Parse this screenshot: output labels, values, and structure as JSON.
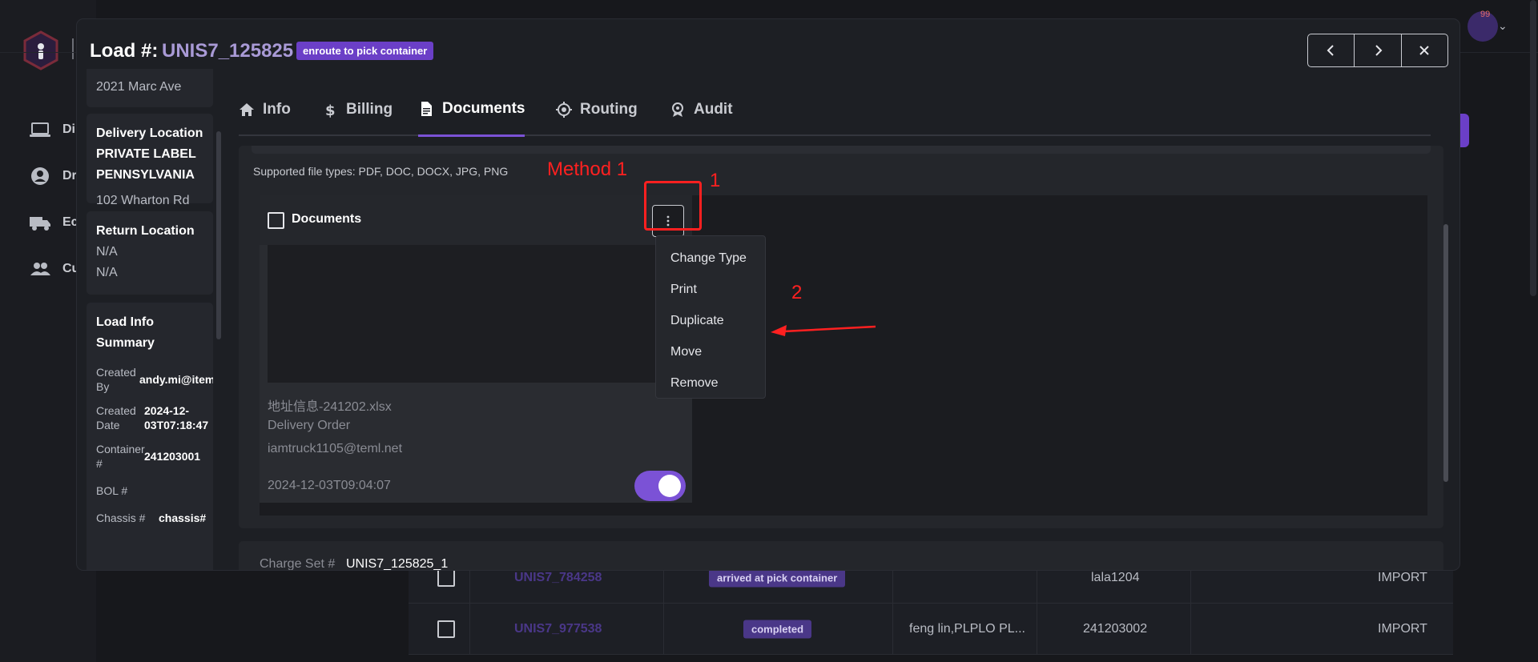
{
  "app": {
    "sidebar_nav": [
      {
        "label": "Di",
        "icon": "laptop-icon"
      },
      {
        "label": "Dr",
        "icon": "driver-icon"
      },
      {
        "label": "Ec",
        "icon": "truck-icon"
      },
      {
        "label": "Cu",
        "icon": "customers-icon"
      }
    ],
    "notification_count": "99"
  },
  "background_table": {
    "rows": [
      {
        "load": "UNIS7_784258",
        "status": "arrived at pick container",
        "customer": "",
        "container": "lala1204",
        "type": "IMPORT"
      },
      {
        "load": "UNIS7_977538",
        "status": "completed",
        "customer": "feng lin,PLPLO PL...",
        "container": "241203002",
        "type": "IMPORT"
      }
    ]
  },
  "modal": {
    "load_label": "Load #:",
    "load_id": "UNIS7_125825",
    "status_badge": "enroute to pick container",
    "left_panel": {
      "pickup_address": "2021 Marc Ave",
      "delivery": {
        "title": "Delivery Location",
        "name_line1": "PRIVATE LABEL",
        "name_line2": "PENNSYLVANIA",
        "address": "102 Wharton Rd"
      },
      "return": {
        "title": "Return Location",
        "line1": "N/A",
        "line2": "N/A"
      },
      "summary": {
        "title_line1": "Load Info",
        "title_line2": "Summary",
        "fields": [
          {
            "k1": "Created",
            "k2": "By",
            "v1": "andy.mi@item.c",
            "v2": ""
          },
          {
            "k1": "Created",
            "k2": "Date",
            "v1": "2024-12-",
            "v2": "03T07:18:47"
          },
          {
            "k1": "Container",
            "k2": "#",
            "v1": "241203001",
            "v2": ""
          },
          {
            "k1": "BOL #",
            "k2": "",
            "v1": "",
            "v2": ""
          },
          {
            "k1": "Chassis #",
            "k2": "",
            "v1": "chassis#",
            "v2": ""
          }
        ]
      }
    },
    "tabs": [
      {
        "label": "Info",
        "icon": "home-icon"
      },
      {
        "label": "Billing",
        "icon": "dollar-icon"
      },
      {
        "label": "Documents",
        "icon": "document-icon"
      },
      {
        "label": "Routing",
        "icon": "routing-icon"
      },
      {
        "label": "Audit",
        "icon": "audit-icon"
      }
    ],
    "active_tab": "Documents",
    "documents": {
      "supported_types": "Supported file types: PDF, DOC, DOCX, JPG, PNG",
      "card": {
        "title": "Documents",
        "file_name": "地址信息-241202.xlsx",
        "doc_type": "Delivery Order",
        "uploaded_by": "iamtruck1105@teml.net",
        "timestamp": "2024-12-03T09:04:07",
        "toggle_on": true
      },
      "menu": [
        "Change Type",
        "Print",
        "Duplicate",
        "Move",
        "Remove"
      ]
    },
    "charge_set": {
      "label": "Charge Set #",
      "value": "UNIS7_125825_1"
    }
  },
  "annotations": {
    "method": "Method 1",
    "step1": "1",
    "step2": "2",
    "color": "#ff2020"
  },
  "colors": {
    "accent": "#7b52d6",
    "badge": "#6b3fc7",
    "background": "#17181c"
  }
}
